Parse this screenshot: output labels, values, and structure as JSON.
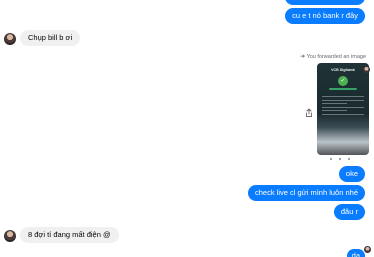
{
  "messages": {
    "out_bank": "cu e t nó bank r đây",
    "in_chup_bill": "Chụp bill b ơi",
    "forward_label": "You forwarded an image",
    "out_oke": "oke",
    "out_check_live": "check live cl gửi mình luôn nhé",
    "out_dau_r": "đâu r",
    "in_mat_dien": "8 đợi tí đang mất điện @",
    "out_partial": "dạ"
  },
  "forwarded_image": {
    "brand": "VCB Digibank",
    "status": "success"
  },
  "colors": {
    "outgoing_bubble": "#0a7cff",
    "incoming_bubble": "#f0f0f0",
    "meta_text": "#65676b"
  },
  "icons": {
    "forward": "forward-arrow-icon",
    "share": "share-icon",
    "success": "check-circle-icon"
  }
}
